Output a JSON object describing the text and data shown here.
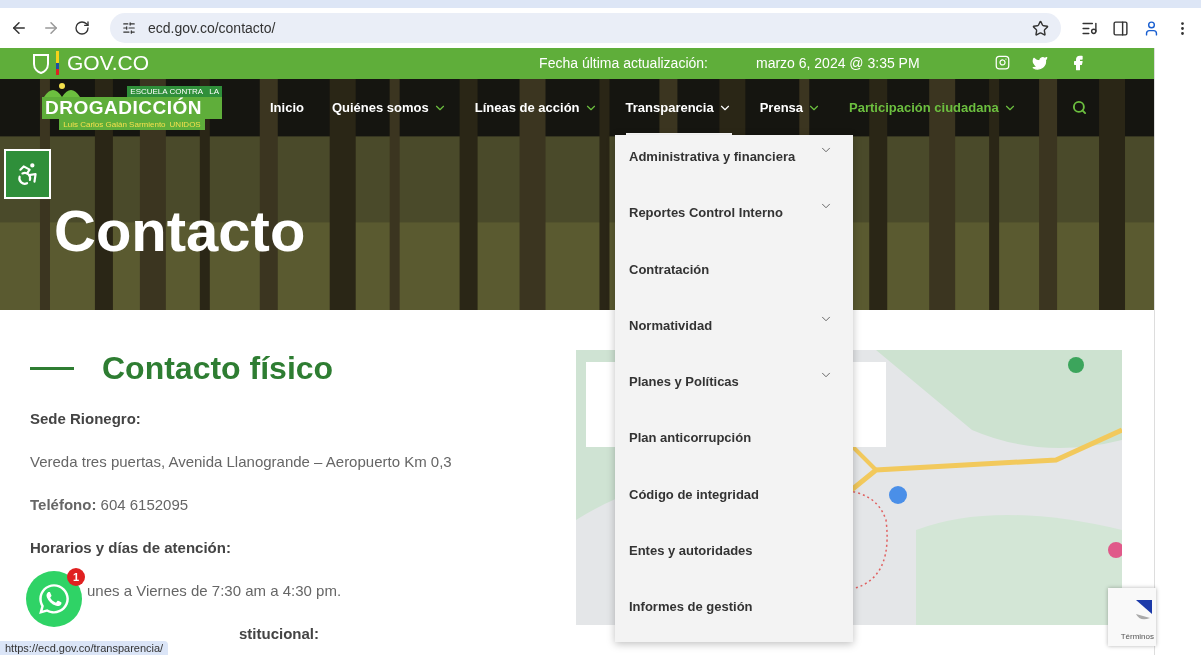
{
  "browser": {
    "url": "ecd.gov.co/contacto/"
  },
  "gov_bar": {
    "brand": "GOV.CO",
    "update_label": "Fecha última actualización:",
    "update_date": "marzo 6, 2024 @ 3:35 PM"
  },
  "header": {
    "logo": {
      "top": "ESCUELA CONTRA",
      "top_end": "LA",
      "main": "DROGADICCIÓN",
      "sub": "Luis Carlos Galán Sarmiento",
      "sub_end": "UNIDOS"
    },
    "nav": [
      {
        "label": "Inicio",
        "has_submenu": false,
        "selected": false,
        "highlighted": false
      },
      {
        "label": "Quiénes somos",
        "has_submenu": true,
        "selected": false,
        "highlighted": false
      },
      {
        "label": "Líneas de acción",
        "has_submenu": true,
        "selected": false,
        "highlighted": false
      },
      {
        "label": "Transparencia",
        "has_submenu": true,
        "selected": true,
        "highlighted": false
      },
      {
        "label": "Prensa",
        "has_submenu": true,
        "selected": false,
        "highlighted": false
      },
      {
        "label": "Participación ciudadana",
        "has_submenu": true,
        "selected": false,
        "highlighted": true
      }
    ]
  },
  "hero": {
    "title": "Contacto"
  },
  "dropdown": [
    {
      "label": "Administrativa y financiera",
      "has_children": true
    },
    {
      "label": "Reportes Control Interno",
      "has_children": true
    },
    {
      "label": "Contratación",
      "has_children": false
    },
    {
      "label": "Normatividad",
      "has_children": true
    },
    {
      "label": "Planes y Políticas",
      "has_children": true
    },
    {
      "label": "Plan anticorrupción",
      "has_children": false
    },
    {
      "label": "Código de integridad",
      "has_children": false
    },
    {
      "label": "Entes y autoridades",
      "has_children": false
    },
    {
      "label": "Informes de gestión",
      "has_children": false
    }
  ],
  "contact": {
    "heading": "Contacto físico",
    "paragraphs": [
      {
        "kind": "label",
        "text": "Sede Rionegro:"
      },
      {
        "kind": "plain",
        "text": "Vereda tres puertas, Avenida Llanogrande – Aeropuerto Km 0,3"
      },
      {
        "kind": "plain",
        "text": "**Teléfono:** 604 6152095"
      },
      {
        "kind": "label",
        "text": "Horarios y días de atención:"
      },
      {
        "kind": "plain",
        "text": "unes a Viernes de 7:30 am a 4:30 pm."
      },
      {
        "kind": "label",
        "text": "stitucional:"
      }
    ]
  },
  "whatsapp": {
    "badge": "1"
  },
  "recaptcha": {
    "terms": "Términos"
  },
  "status_link": "https://ecd.gov.co/transparencia/"
}
